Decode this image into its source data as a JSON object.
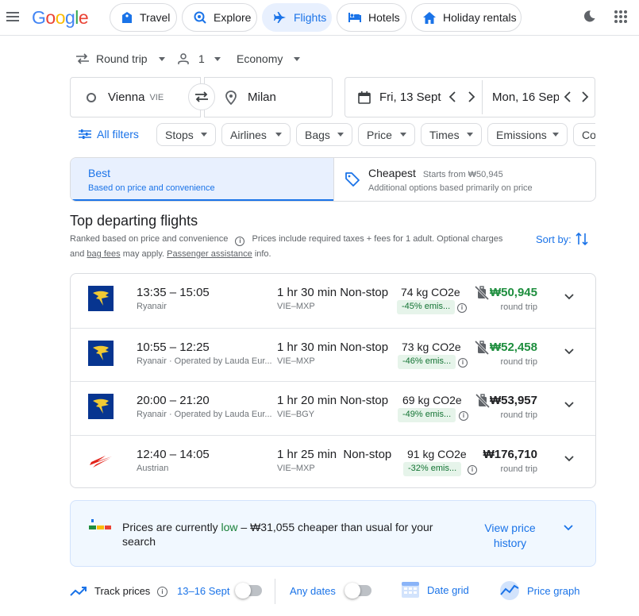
{
  "header": {
    "logo": "Google",
    "nav": [
      {
        "label": "Travel",
        "icon": "travel-tag-icon"
      },
      {
        "label": "Explore",
        "icon": "explore-icon"
      },
      {
        "label": "Flights",
        "icon": "airplane-icon"
      },
      {
        "label": "Hotels",
        "icon": "bed-icon"
      },
      {
        "label": "Holiday rentals",
        "icon": "house-icon"
      }
    ],
    "active_tab": "Flights"
  },
  "search": {
    "trip_type": "Round trip",
    "passengers": "1",
    "cabin": "Economy",
    "origin_city": "Vienna",
    "origin_code": "VIE",
    "destination": "Milan",
    "depart_date": "Fri, 13 Sept",
    "return_date": "Mon, 16 Sept"
  },
  "filters": {
    "all_filters": "All filters",
    "chips": [
      "Stops",
      "Airlines",
      "Bags",
      "Price",
      "Times",
      "Emissions",
      "Co"
    ]
  },
  "sort_tabs": {
    "best_title": "Best",
    "best_sub": "Based on price and convenience",
    "cheapest_title": "Cheapest",
    "cheapest_from": "Starts from ₩50,945",
    "cheapest_sub": "Additional options based primarily on price"
  },
  "results": {
    "heading": "Top departing flights",
    "ranked": "Ranked based on price and convenience",
    "note_a": "Prices include required taxes + fees for 1 adult. Optional charges",
    "note_b_prefix": "and",
    "bag_fees": "bag fees",
    "note_b_mid": "may apply.",
    "passenger_assistance": "Passenger assistance",
    "note_b_suffix": "info.",
    "sort_by": "Sort by:"
  },
  "flights": [
    {
      "times": "13:35 – 15:05",
      "airline": "Ryanair",
      "duration": "1 hr 30 min",
      "stops": "Non-stop",
      "route": "VIE–MXP",
      "co2": "74 kg CO2e",
      "emissions": "-45% emis...",
      "price": "₩50,945",
      "price_type": "round trip",
      "logo": "ryanair-logo",
      "green": true,
      "bag_icon": true
    },
    {
      "times": "10:55 – 12:25",
      "airline": "Ryanair · Operated by Lauda Eur...",
      "duration": "1 hr 30 min",
      "stops": "Non-stop",
      "route": "VIE–MXP",
      "co2": "73 kg CO2e",
      "emissions": "-46% emis...",
      "price": "₩52,458",
      "price_type": "round trip",
      "logo": "ryanair-logo",
      "green": true,
      "bag_icon": true
    },
    {
      "times": "20:00 – 21:20",
      "airline": "Ryanair · Operated by Lauda Eur...",
      "duration": "1 hr 20 min",
      "stops": "Non-stop",
      "route": "VIE–BGY",
      "co2": "69 kg CO2e",
      "emissions": "-49% emis...",
      "price": "₩53,957",
      "price_type": "round trip",
      "logo": "ryanair-logo",
      "green": false,
      "bag_icon": true
    },
    {
      "times": "12:40 – 14:05",
      "airline": "Austrian",
      "duration": "1 hr 25 min",
      "stops": "Non-stop",
      "route": "VIE–MXP",
      "co2": "91 kg CO2e",
      "emissions": "-32% emis...",
      "price": "₩176,710",
      "price_type": "round trip",
      "logo": "austrian-logo",
      "green": false,
      "bag_icon": false
    }
  ],
  "insight": {
    "prefix": "Prices are currently",
    "level": "low",
    "suffix": "– ₩31,055 cheaper than usual for your",
    "line2": "search",
    "link_l1": "View price",
    "link_l2": "history"
  },
  "bottom": {
    "track_prices": "Track prices",
    "date_range": "13–16 Sept",
    "any_dates": "Any dates",
    "date_grid": "Date grid",
    "price_graph": "Price graph"
  },
  "colors": {
    "accent": "#1a73e8",
    "green_price": "#1e8e3e",
    "emissions_bg": "#e6f4ea",
    "low_green": "#188038",
    "ryanair_blue": "#073590",
    "ryanair_gold": "#f1c933",
    "austrian_red": "#e2231a"
  }
}
